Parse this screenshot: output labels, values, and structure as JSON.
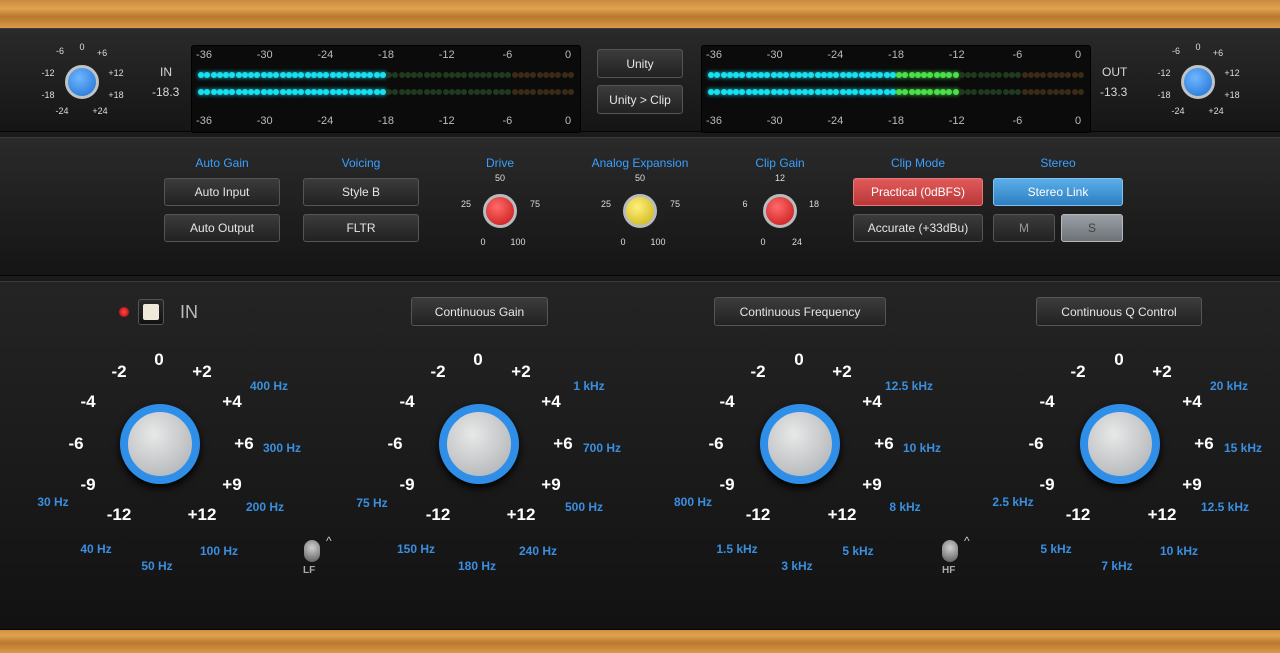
{
  "io": {
    "in_label": "IN",
    "in_value": "-18.3",
    "out_label": "OUT",
    "out_value": "-13.3",
    "trim_ticks": [
      "-6",
      "0",
      "+6",
      "-12",
      "+12",
      "-18",
      "+18",
      "-24",
      "+24"
    ],
    "meter_scale": [
      "-36",
      "-30",
      "-24",
      "-18",
      "-12",
      "-6",
      "0"
    ],
    "in_level_db": -18,
    "out_level_db": -12,
    "unity_label": "Unity",
    "unity_clip_label": "Unity > Clip"
  },
  "controls": {
    "auto_gain": {
      "title": "Auto Gain",
      "input": "Auto Input",
      "output": "Auto Output"
    },
    "voicing": {
      "title": "Voicing",
      "style": "Style B",
      "fltr": "FLTR"
    },
    "drive": {
      "title": "Drive",
      "ticks": [
        "50",
        "25",
        "75",
        "0",
        "100"
      ]
    },
    "analog_expansion": {
      "title": "Analog Expansion",
      "ticks": [
        "50",
        "25",
        "75",
        "0",
        "100"
      ]
    },
    "clip_gain": {
      "title": "Clip Gain",
      "ticks": [
        "12",
        "6",
        "18",
        "0",
        "24"
      ]
    },
    "clip_mode": {
      "title": "Clip Mode",
      "practical": "Practical (0dBFS)",
      "accurate": "Accurate (+33dBu)"
    },
    "stereo": {
      "title": "Stereo",
      "link": "Stereo Link",
      "m": "M",
      "s": "S"
    }
  },
  "eq": {
    "in_label": "IN",
    "continuous_gain": "Continuous Gain",
    "continuous_frequency": "Continuous Frequency",
    "continuous_q": "Continuous Q Control",
    "gain_ticks": [
      "-2",
      "0",
      "+2",
      "-4",
      "+4",
      "-6",
      "+6",
      "-9",
      "+9",
      "-12",
      "+12"
    ],
    "lf_freqs": [
      "400 Hz",
      "300 Hz",
      "200 Hz",
      "100 Hz",
      "50 Hz",
      "40 Hz",
      "30 Hz"
    ],
    "lmf_freqs": [
      "1 kHz",
      "700 Hz",
      "500 Hz",
      "240 Hz",
      "180 Hz",
      "150 Hz",
      "75 Hz"
    ],
    "hmf_freqs": [
      "12.5 kHz",
      "10 kHz",
      "8 kHz",
      "5 kHz",
      "3 kHz",
      "1.5 kHz",
      "800 Hz"
    ],
    "hf_freqs": [
      "20 kHz",
      "15 kHz",
      "12.5 kHz",
      "10 kHz",
      "7 kHz",
      "5 kHz",
      "2.5 kHz"
    ],
    "lf_switch": "LF",
    "hf_switch": "HF",
    "colors": {
      "accent_blue": "#2f8ee8",
      "led_cyan": "#18e0f0",
      "led_green": "#4be04b",
      "knob_red": "#e02828",
      "knob_yellow": "#e8d21e"
    }
  }
}
